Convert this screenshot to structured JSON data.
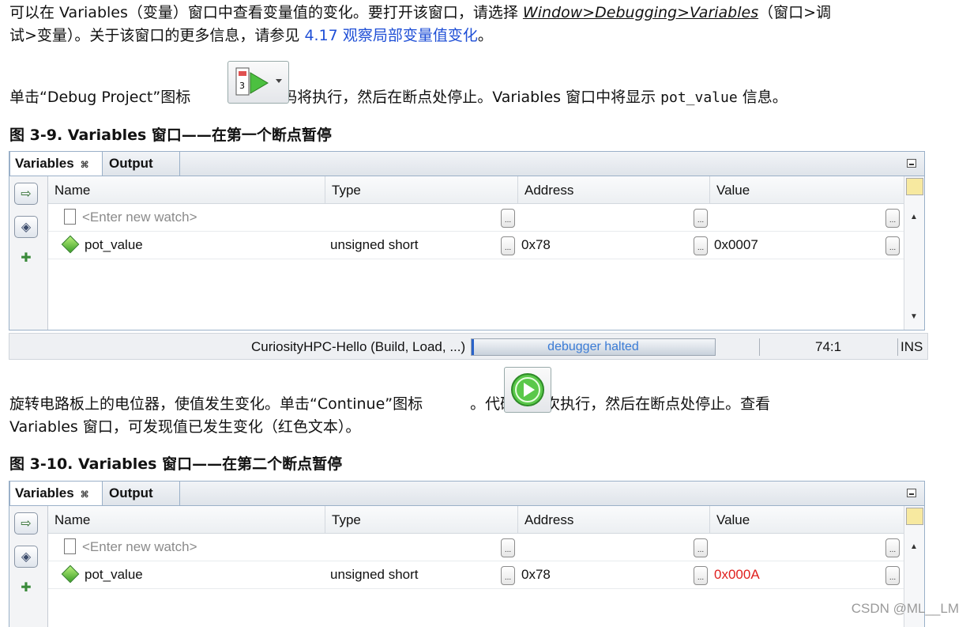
{
  "intro": {
    "line1_a": "可以在 Variables（变量）窗口中查看变量值的变化。要打开该窗口，请选择 ",
    "menu_path": "Window>Debugging>Variables",
    "line1_b": "（窗口>调",
    "line2_a": "试>变量）。关于该窗口的更多信息，请参见 ",
    "xref": "4.17  观察局部变量值变化",
    "line2_b": "。"
  },
  "debug_para": {
    "before_icon": "单击“Debug Project”图标",
    "after_icon": "。代码将执行，然后在断点处停止。Variables 窗口中将显示 ",
    "code": "pot_value",
    "end": " 信息。"
  },
  "fig1_caption": "图 3-9.  Variables 窗口——在第一个断点暂停",
  "fig2_caption": "图 3-10.  Variables 窗口——在第二个断点暂停",
  "continue_para": {
    "line1_a": "旋转电路板上的电位器，使值发生变化。单击“Continue”图标",
    "line1_b": "。代码将再次执行，然后在断点处停止。查看",
    "line2": "Variables 窗口，可发现值已发生变化（红色文本）。"
  },
  "panel": {
    "tabs": [
      "Variables",
      "Output"
    ],
    "tab_close": "⌘",
    "columns": [
      "Name",
      "Type",
      "Address",
      "Value"
    ],
    "ellipsis": "...",
    "watch_placeholder": "<Enter new watch>"
  },
  "fig1_rows": [
    {
      "name": "pot_value",
      "type": "unsigned short",
      "address": "0x78",
      "value": "0x0007"
    }
  ],
  "fig2_rows": [
    {
      "name": "pot_value",
      "type": "unsigned short",
      "address": "0x78",
      "value": "0x000A"
    }
  ],
  "statusbar": {
    "project": "CuriosityHPC-Hello (Build, Load, ...)",
    "progress_text": "debugger halted",
    "position": "74:1",
    "mode": "INS"
  },
  "colors": {
    "changed_value": "#e0201e",
    "xref": "#1f4fd6"
  },
  "watermark": "CSDN @ML__LM"
}
